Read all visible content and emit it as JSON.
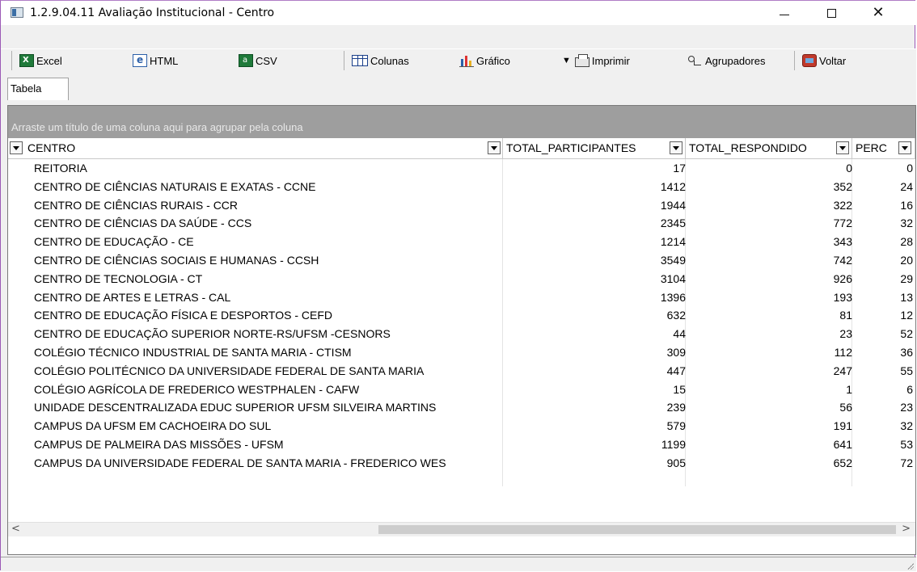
{
  "window": {
    "title": "1.2.9.04.11 Avaliação Institucional - Centro",
    "minimize": "—",
    "maximize": "☐",
    "close": "✕"
  },
  "toolbar": {
    "excel": "Excel",
    "html": "HTML",
    "csv": "CSV",
    "columns": "Colunas",
    "chart": "Gráfico",
    "print": "Imprimir",
    "groupers": "Agrupadores",
    "back": "Voltar"
  },
  "tabs": [
    "Tabela"
  ],
  "grid": {
    "group_hint": "Arraste um título de uma coluna aqui para agrupar pela coluna",
    "columns": [
      "CENTRO",
      "TOTAL_PARTICIPANTES",
      "TOTAL_RESPONDIDO",
      "PERC"
    ],
    "rows": [
      {
        "centro": "REITORIA",
        "participantes": "17",
        "respondido": "0",
        "perc": "0"
      },
      {
        "centro": "CENTRO DE CIÊNCIAS NATURAIS E EXATAS - CCNE",
        "participantes": "1412",
        "respondido": "352",
        "perc": "24"
      },
      {
        "centro": "CENTRO DE CIÊNCIAS RURAIS - CCR",
        "participantes": "1944",
        "respondido": "322",
        "perc": "16"
      },
      {
        "centro": "CENTRO DE CIÊNCIAS DA SAÚDE - CCS",
        "participantes": "2345",
        "respondido": "772",
        "perc": "32"
      },
      {
        "centro": "CENTRO DE EDUCAÇÃO - CE",
        "participantes": "1214",
        "respondido": "343",
        "perc": "28"
      },
      {
        "centro": "CENTRO DE CIÊNCIAS SOCIAIS E HUMANAS - CCSH",
        "participantes": "3549",
        "respondido": "742",
        "perc": "20"
      },
      {
        "centro": "CENTRO DE TECNOLOGIA - CT",
        "participantes": "3104",
        "respondido": "926",
        "perc": "29"
      },
      {
        "centro": "CENTRO DE ARTES E LETRAS - CAL",
        "participantes": "1396",
        "respondido": "193",
        "perc": "13"
      },
      {
        "centro": "CENTRO DE EDUCAÇÃO FÍSICA E DESPORTOS - CEFD",
        "participantes": "632",
        "respondido": "81",
        "perc": "12"
      },
      {
        "centro": "CENTRO DE EDUCAÇÃO SUPERIOR NORTE-RS/UFSM -CESNORS",
        "participantes": "44",
        "respondido": "23",
        "perc": "52"
      },
      {
        "centro": "COLÉGIO TÉCNICO INDUSTRIAL DE SANTA MARIA - CTISM",
        "participantes": "309",
        "respondido": "112",
        "perc": "36"
      },
      {
        "centro": "COLÉGIO POLITÉCNICO DA UNIVERSIDADE FEDERAL DE SANTA MARIA",
        "participantes": "447",
        "respondido": "247",
        "perc": "55"
      },
      {
        "centro": "COLÉGIO AGRÍCOLA DE FREDERICO WESTPHALEN - CAFW",
        "participantes": "15",
        "respondido": "1",
        "perc": "6"
      },
      {
        "centro": "UNIDADE DESCENTRALIZADA EDUC SUPERIOR UFSM SILVEIRA MARTINS",
        "participantes": "239",
        "respondido": "56",
        "perc": "23"
      },
      {
        "centro": "CAMPUS DA UFSM EM CACHOEIRA DO SUL",
        "participantes": "579",
        "respondido": "191",
        "perc": "32"
      },
      {
        "centro": "CAMPUS DE PALMEIRA DAS MISSÕES - UFSM",
        "participantes": "1199",
        "respondido": "641",
        "perc": "53"
      },
      {
        "centro": "CAMPUS DA UNIVERSIDADE FEDERAL DE SANTA MARIA - FREDERICO WES",
        "participantes": "905",
        "respondido": "652",
        "perc": "72"
      }
    ]
  },
  "scrollbar": {
    "left": "<",
    "right": ">"
  }
}
